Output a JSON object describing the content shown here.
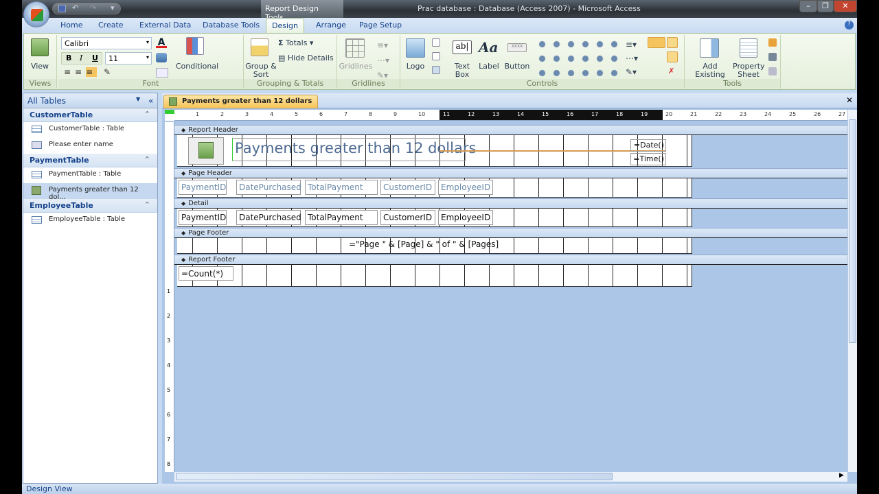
{
  "window": {
    "context_tab": "Report Design Tools",
    "title": "Prac database : Database (Access 2007) - Microsoft Access"
  },
  "tabs": [
    "Home",
    "Create",
    "External Data",
    "Database Tools",
    "Design",
    "Arrange",
    "Page Setup"
  ],
  "active_tab": "Design",
  "ribbon": {
    "views": {
      "label": "Views",
      "view": "View"
    },
    "font": {
      "label": "Font",
      "font_name": "Calibri",
      "font_size": "11",
      "bold": "B",
      "italic": "I",
      "underline": "U",
      "conditional": "Conditional"
    },
    "grouping": {
      "label": "Grouping & Totals",
      "group_sort": "Group & Sort",
      "totals": "Totals",
      "hide_details": "Hide Details"
    },
    "gridlines": {
      "label": "Gridlines",
      "gridlines": "Gridlines"
    },
    "controls": {
      "label": "Controls",
      "logo": "Logo",
      "text_box": "Text Box",
      "label_btn": "Label",
      "button": "Button",
      "aa": "Aa",
      "ab": "ab|",
      "xxxx": "XXXX"
    },
    "tools": {
      "label": "Tools",
      "add_existing_fields": "Add Existing Fields",
      "property_sheet": "Property Sheet"
    }
  },
  "nav": {
    "header": "All Tables",
    "groups": [
      {
        "name": "CustomerTable",
        "items": [
          {
            "label": "CustomerTable : Table",
            "type": "table"
          },
          {
            "label": "Please enter name",
            "type": "query"
          }
        ]
      },
      {
        "name": "PaymentTable",
        "items": [
          {
            "label": "PaymentTable : Table",
            "type": "table"
          },
          {
            "label": "Payments greater than 12 dol...",
            "type": "report",
            "selected": true
          }
        ]
      },
      {
        "name": "EmployeeTable",
        "items": [
          {
            "label": "EmployeeTable : Table",
            "type": "table"
          }
        ]
      }
    ]
  },
  "document": {
    "tab": "Payments greater than 12 dollars",
    "sections": {
      "report_header": "Report Header",
      "page_header": "Page Header",
      "detail": "Detail",
      "page_footer": "Page Footer",
      "report_footer": "Report Footer"
    },
    "title": "Payments greater than 12 dollars",
    "date_expr": "=Date()",
    "time_expr": "=Time()",
    "header_labels": [
      "PaymentID",
      "DatePurchased",
      "TotalPayment",
      "CustomerID",
      "EmployeeID"
    ],
    "detail_fields": [
      "PaymentID",
      "DatePurchased",
      "TotalPayment",
      "CustomerID",
      "EmployeeID"
    ],
    "page_expr": "=\"Page \" & [Page] & \" of \" & [Pages]",
    "count_expr": "=Count(*)"
  },
  "status": "Design View"
}
